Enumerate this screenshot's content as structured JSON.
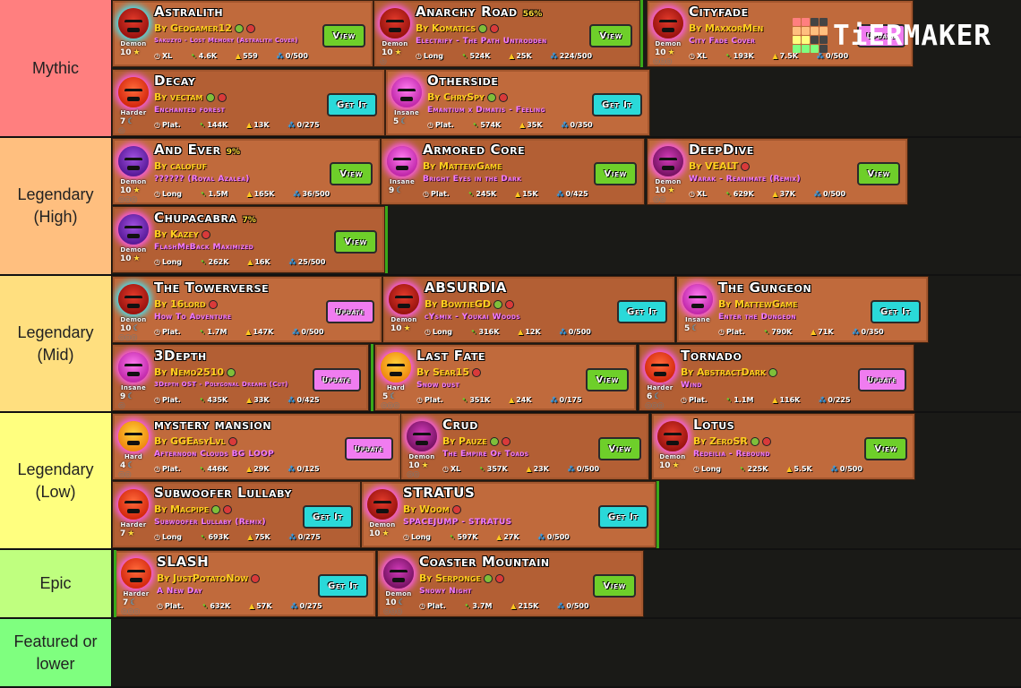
{
  "watermark": {
    "text": "TiERMAKER",
    "grid_colors": [
      "#ff7f7f",
      "#ff7f7f",
      "#444",
      "#444",
      "#ffbf7f",
      "#ffbf7f",
      "#ffbf7f",
      "#ffbf7f",
      "#ffff7f",
      "#ffff7f",
      "#444",
      "#444",
      "#7fff7f",
      "#7fff7f",
      "#7fff7f",
      "#444"
    ]
  },
  "tiers": [
    {
      "label": "Mythic",
      "color": "#ff7f7f",
      "items": [
        {
          "title": "Astralith",
          "pct": "",
          "author": "By Geogamer12",
          "badges": [
            "green",
            "red"
          ],
          "song": "Sakuzyo - Lost Memory (Astralith Cover)",
          "difficulty": "Demon",
          "face": "demon-red",
          "glow": "cyan",
          "stars": "10",
          "star_icon": "star",
          "coins": "",
          "length": "XL",
          "downloads": "4.6K",
          "likes": "559",
          "orbs": "0/500",
          "button": "View",
          "btype": "view"
        },
        {
          "title": "Anarchy Road",
          "pct": "56%",
          "author": "By Komatics",
          "badges": [
            "green",
            "red"
          ],
          "song": "Electrify - The Path Untrodden",
          "difficulty": "Demon",
          "face": "demon-red",
          "glow": "pink",
          "stars": "10",
          "star_icon": "star",
          "coins": "◎",
          "length": "Long",
          "downloads": "524K",
          "likes": "25K",
          "orbs": "224/500",
          "button": "View",
          "btype": "view"
        },
        {
          "title": "Cityfade",
          "pct": "",
          "author": "By MaxxorMen",
          "badges": [],
          "song": "City Fade Cover",
          "difficulty": "Demon",
          "face": "demon-red",
          "glow": "pink",
          "stars": "10",
          "star_icon": "star",
          "coins": "◎◎◎",
          "length": "XL",
          "downloads": "193K",
          "likes": "7.5K",
          "orbs": "0/500",
          "button": "Update",
          "btype": "update"
        },
        {
          "title": "Decay",
          "pct": "",
          "author": "By vectam",
          "badges": [
            "green",
            "red"
          ],
          "song": "Enchanted forest",
          "difficulty": "Harder",
          "face": "harder",
          "glow": "pink",
          "stars": "7",
          "star_icon": "moon",
          "coins": "◎",
          "length": "Plat.",
          "downloads": "144K",
          "likes": "13K",
          "orbs": "0/275",
          "button": "Get It",
          "btype": "get"
        },
        {
          "title": "Otherside",
          "pct": "",
          "author": "By ChrySpy",
          "badges": [
            "green",
            "red"
          ],
          "song": "Emantium x Dimatis - Feeling",
          "difficulty": "Insane",
          "face": "insane",
          "glow": "pink",
          "stars": "5",
          "star_icon": "moon",
          "coins": "",
          "length": "Plat.",
          "downloads": "574K",
          "likes": "35K",
          "orbs": "0/350",
          "button": "Get It",
          "btype": "get"
        }
      ]
    },
    {
      "label": "Legendary (High)",
      "color": "#ffbf7f",
      "items": [
        {
          "title": "And Ever",
          "pct": "9%",
          "author": "By calofuf",
          "badges": [],
          "song": "?????? (Royal Azalea)",
          "difficulty": "Demon",
          "face": "demon-purple",
          "glow": "pink",
          "stars": "10",
          "star_icon": "star",
          "coins": "◎◎◎",
          "length": "Long",
          "downloads": "1.5M",
          "likes": "165K",
          "orbs": "36/500",
          "button": "View",
          "btype": "view"
        },
        {
          "title": "Armored Core",
          "pct": "",
          "author": "By MattewGame",
          "badges": [],
          "song": "Bright Eyes in the Dark",
          "difficulty": "Insane",
          "face": "insane",
          "glow": "pink",
          "stars": "9",
          "star_icon": "moon",
          "coins": "",
          "length": "Plat.",
          "downloads": "245K",
          "likes": "15K",
          "orbs": "0/425",
          "button": "View",
          "btype": "view"
        },
        {
          "title": "DeepDive",
          "pct": "",
          "author": "By VEALT",
          "badges": [
            "red"
          ],
          "song": "Warak - Reanimate (Remix)",
          "difficulty": "Demon",
          "face": "demon-magenta",
          "glow": "pink",
          "stars": "10",
          "star_icon": "star",
          "coins": "◎◎",
          "length": "XL",
          "downloads": "629K",
          "likes": "37K",
          "orbs": "0/500",
          "button": "View",
          "btype": "view"
        },
        {
          "title": "Chupacabra",
          "pct": "7%",
          "author": "By Kazey",
          "badges": [
            "red"
          ],
          "song": "FlashMeBack Maximized",
          "difficulty": "Demon",
          "face": "demon-purple",
          "glow": "pink",
          "stars": "10",
          "star_icon": "star",
          "coins": "",
          "length": "Long",
          "downloads": "262K",
          "likes": "16K",
          "orbs": "25/500",
          "button": "View",
          "btype": "view"
        }
      ]
    },
    {
      "label": "Legendary (Mid)",
      "color": "#ffdf7f",
      "items": [
        {
          "title": "The Towerverse",
          "pct": "",
          "author": "By 16lord",
          "badges": [
            "red"
          ],
          "song": "How To Adventure",
          "difficulty": "Demon",
          "face": "demon-red",
          "glow": "cyan",
          "stars": "10",
          "star_icon": "moon",
          "coins": "◎◎◎",
          "length": "Plat.",
          "downloads": "1.7M",
          "likes": "147K",
          "orbs": "0/500",
          "button": "Update",
          "btype": "update"
        },
        {
          "title": "ABSURDIA",
          "pct": "",
          "author": "By BowtieGD",
          "badges": [
            "green",
            "red"
          ],
          "song": "cYsmix - Youkai Woods",
          "difficulty": "Demon",
          "face": "demon-red",
          "glow": "pink",
          "stars": "10",
          "star_icon": "star",
          "coins": "",
          "length": "Long",
          "downloads": "316K",
          "likes": "12K",
          "orbs": "0/500",
          "button": "Get It",
          "btype": "get"
        },
        {
          "title": "The Gungeon",
          "pct": "",
          "author": "By MattewGame",
          "badges": [],
          "song": "Enter the Dungeon",
          "difficulty": "Insane",
          "face": "insane",
          "glow": "pink",
          "stars": "5",
          "star_icon": "moon",
          "coins": "",
          "length": "Plat.",
          "downloads": "790K",
          "likes": "71K",
          "orbs": "0/350",
          "button": "Get It",
          "btype": "get"
        },
        {
          "title": "3Depth",
          "pct": "",
          "author": "By Nemo2510",
          "badges": [
            "green"
          ],
          "song": "3Depth OST - Polygonal Dreams (Cut)",
          "difficulty": "Insane",
          "face": "insane",
          "glow": "pink",
          "stars": "9",
          "star_icon": "moon",
          "coins": "◎",
          "length": "Plat.",
          "downloads": "435K",
          "likes": "33K",
          "orbs": "0/425",
          "button": "Update",
          "btype": "update"
        },
        {
          "title": "Last Fate",
          "pct": "",
          "author": "By Sear15",
          "badges": [
            "red"
          ],
          "song": "Snow dust",
          "difficulty": "Hard",
          "face": "hard",
          "glow": "pink",
          "stars": "5",
          "star_icon": "moon",
          "coins": "◎◎◎",
          "length": "Plat.",
          "downloads": "351K",
          "likes": "24K",
          "orbs": "0/175",
          "button": "View",
          "btype": "view"
        },
        {
          "title": "Tornado",
          "pct": "",
          "author": "By AbstractDark",
          "badges": [
            "green"
          ],
          "song": "Wind",
          "difficulty": "Harder",
          "face": "harder",
          "glow": "pink",
          "stars": "6",
          "star_icon": "moon",
          "coins": "◎◎◎",
          "length": "Plat.",
          "downloads": "1.1M",
          "likes": "116K",
          "orbs": "0/225",
          "button": "Update",
          "btype": "update"
        }
      ]
    },
    {
      "label": "Legendary (Low)",
      "color": "#ffff7f",
      "items": [
        {
          "title": "mystery mansion",
          "pct": "",
          "author": "By GGEasyLvl",
          "badges": [
            "red"
          ],
          "song": "Afternoon Clouds BG LOOP",
          "difficulty": "Hard",
          "face": "hard",
          "glow": "pink",
          "stars": "4",
          "star_icon": "moon",
          "coins": "◎◎",
          "length": "Plat.",
          "downloads": "446K",
          "likes": "29K",
          "orbs": "0/125",
          "button": "Update",
          "btype": "update"
        },
        {
          "title": "Crud",
          "pct": "",
          "author": "By Pauze",
          "badges": [
            "green",
            "red"
          ],
          "song": "The Empire Of Toads",
          "difficulty": "Demon",
          "face": "demon-magenta",
          "glow": "pink",
          "stars": "10",
          "star_icon": "star",
          "coins": "◎◎",
          "length": "XL",
          "downloads": "357K",
          "likes": "23K",
          "orbs": "0/500",
          "button": "View",
          "btype": "view"
        },
        {
          "title": "Lotus",
          "pct": "",
          "author": "By ZeroSR",
          "badges": [
            "green",
            "red"
          ],
          "song": "Redeilia - Rebound",
          "difficulty": "Demon",
          "face": "demon-red",
          "glow": "pink",
          "stars": "10",
          "star_icon": "star",
          "coins": "",
          "length": "Long",
          "downloads": "225K",
          "likes": "5.5K",
          "orbs": "0/500",
          "button": "View",
          "btype": "view"
        },
        {
          "title": "Subwoofer Lullaby",
          "pct": "",
          "author": "By Macpipe",
          "badges": [
            "green",
            "red"
          ],
          "song": "Subwoofer Lullaby (Remix)",
          "difficulty": "Harder",
          "face": "harder",
          "glow": "pink",
          "stars": "7",
          "star_icon": "star",
          "coins": "",
          "length": "Long",
          "downloads": "693K",
          "likes": "75K",
          "orbs": "0/275",
          "button": "Get It",
          "btype": "get"
        },
        {
          "title": "STRATUS",
          "pct": "",
          "author": "By Woom",
          "badges": [
            "red"
          ],
          "song": "SPACEJUMP - STRATUS",
          "difficulty": "Demon",
          "face": "demon-red",
          "glow": "pink",
          "stars": "10",
          "star_icon": "star",
          "coins": "",
          "length": "Long",
          "downloads": "597K",
          "likes": "27K",
          "orbs": "0/500",
          "button": "Get It",
          "btype": "get"
        }
      ]
    },
    {
      "label": "Epic",
      "color": "#bfff7f",
      "items": [
        {
          "title": "SLASH",
          "pct": "",
          "author": "By JustPotatoNow",
          "badges": [
            "red"
          ],
          "song": "A New Day",
          "difficulty": "Harder",
          "face": "harder",
          "glow": "pink",
          "stars": "7",
          "star_icon": "moon",
          "coins": "◎◎◎",
          "length": "Plat.",
          "downloads": "632K",
          "likes": "57K",
          "orbs": "0/275",
          "button": "Get It",
          "btype": "get"
        },
        {
          "title": "Coaster Mountain",
          "pct": "",
          "author": "By Serponge",
          "badges": [
            "green",
            "red"
          ],
          "song": "Snowy Night",
          "difficulty": "Demon",
          "face": "demon-magenta",
          "glow": "pink",
          "stars": "10",
          "star_icon": "moon",
          "coins": "◎◎◎",
          "length": "Plat.",
          "downloads": "3.7M",
          "likes": "215K",
          "orbs": "0/500",
          "button": "View",
          "btype": "view"
        }
      ]
    },
    {
      "label": "Featured or lower",
      "color": "#7fff7f",
      "items": []
    }
  ]
}
